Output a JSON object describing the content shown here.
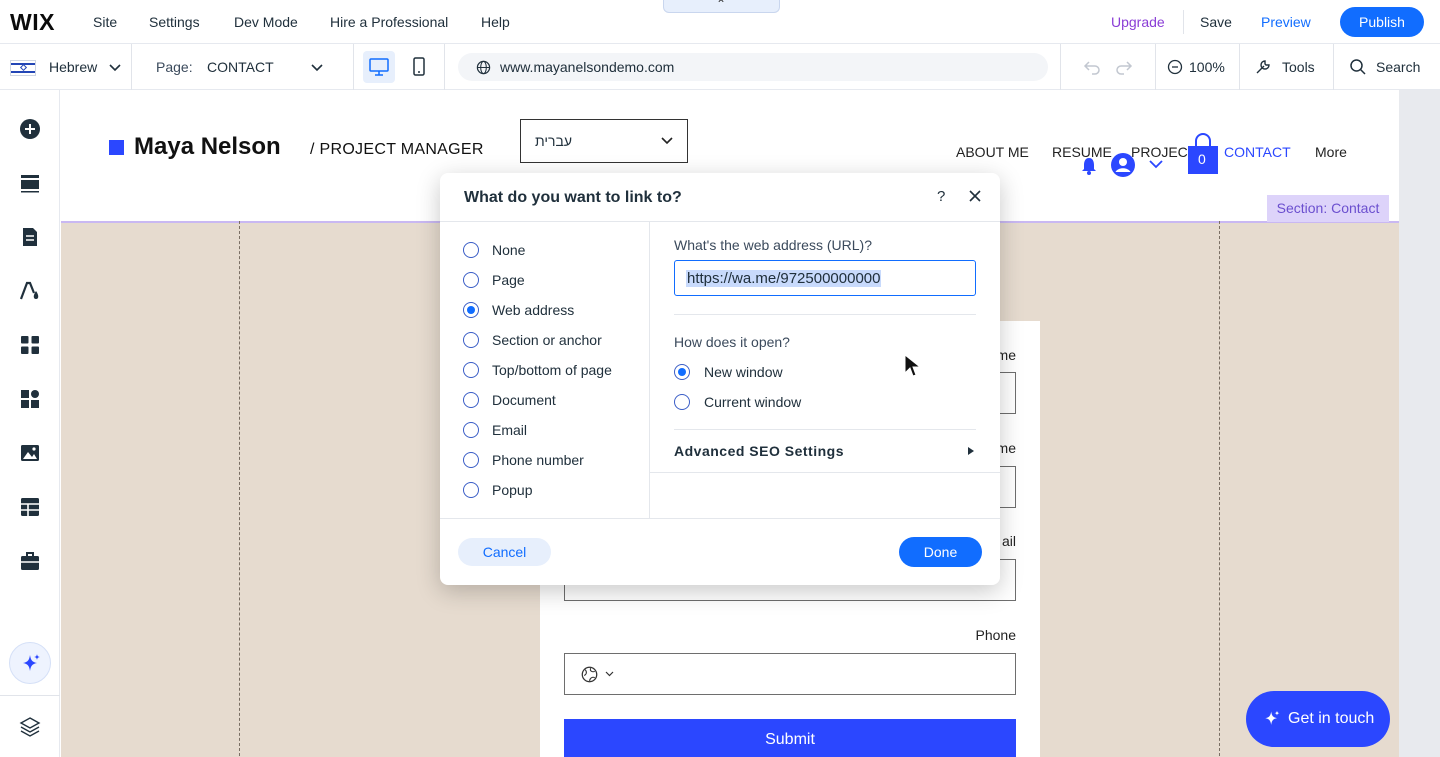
{
  "topbar": {
    "logo": "WIX",
    "menu": [
      "Site",
      "Settings",
      "Dev Mode",
      "Hire a Professional",
      "Help"
    ],
    "collapse_glyph": "⌃",
    "upgrade": "Upgrade",
    "save": "Save",
    "preview": "Preview",
    "publish": "Publish"
  },
  "toolbar": {
    "language": "Hebrew",
    "page_label": "Page:",
    "page_name": "CONTACT",
    "url": "www.mayanelsondemo.com",
    "zoom": "100%",
    "tools": "Tools",
    "search": "Search"
  },
  "sidebar": {
    "icons": [
      "add-icon",
      "sections-icon",
      "pages-icon",
      "design-icon",
      "apps-icon",
      "business-apps-icon",
      "media-icon",
      "cms-icon",
      "portfolio-icon",
      "ai-assistant-icon",
      "layers-icon"
    ]
  },
  "site": {
    "name": "Maya Nelson",
    "role": "/  PROJECT MANAGER",
    "language_select": "עברית",
    "nav": [
      "ABOUT ME",
      "RESUME",
      "PROJECT",
      "CONTACT",
      "More"
    ],
    "active_nav": "CONTACT",
    "cart_count": "0",
    "section_tag": "Section: Contact",
    "form": {
      "label_partial_1": "me",
      "label_partial_2": "me",
      "label_partial_3": "ail",
      "phone_label": "Phone",
      "submit": "Submit"
    },
    "get_in_touch": "Get in touch"
  },
  "dialog": {
    "title": "What do you want to link to?",
    "help": "?",
    "link_types": [
      "None",
      "Page",
      "Web address",
      "Section or anchor",
      "Top/bottom of page",
      "Document",
      "Email",
      "Phone number",
      "Popup"
    ],
    "selected_link_type": "Web address",
    "url_question": "What's the web address (URL)?",
    "url_value": "https://wa.me/972500000000",
    "open_question": "How does it open?",
    "open_options": [
      "New window",
      "Current window"
    ],
    "selected_open": "New window",
    "seo": "Advanced SEO Settings",
    "cancel": "Cancel",
    "done": "Done"
  },
  "colors": {
    "accent": "#116dff",
    "site_blue": "#2b47ff",
    "section_bg": "#e6dbcf",
    "upgrade": "#8a3dd6"
  }
}
